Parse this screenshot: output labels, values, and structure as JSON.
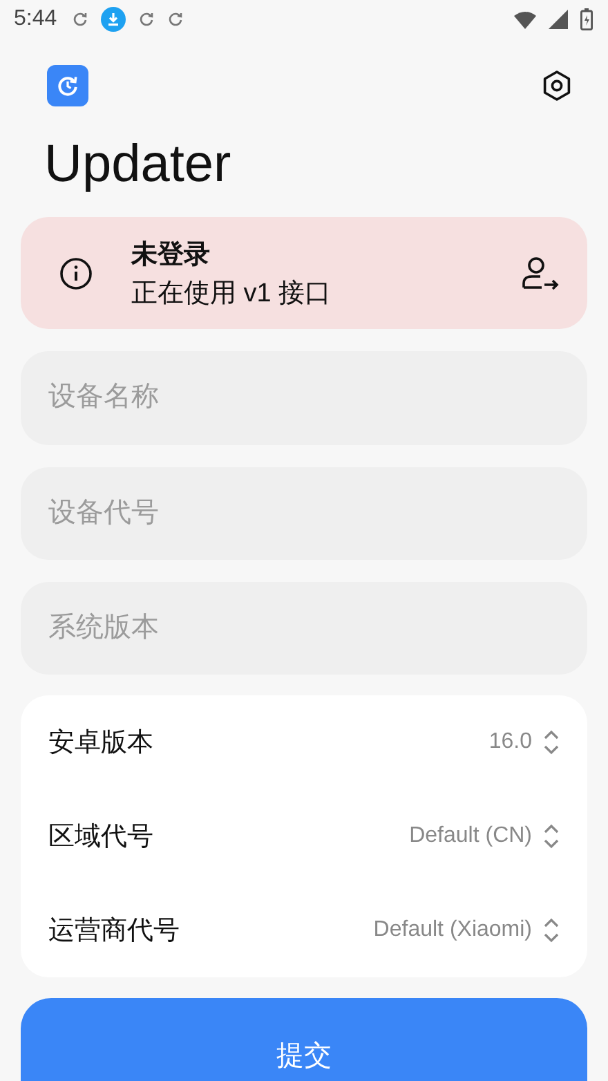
{
  "status_bar": {
    "time": "5:44"
  },
  "header": {
    "title": "Updater"
  },
  "login_card": {
    "title": "未登录",
    "subtitle": "正在使用 v1 接口"
  },
  "fields": [
    {
      "placeholder": "设备名称"
    },
    {
      "placeholder": "设备代号"
    },
    {
      "placeholder": "系统版本"
    }
  ],
  "selectors": [
    {
      "label": "安卓版本",
      "value": "16.0"
    },
    {
      "label": "区域代号",
      "value": "Default (CN)"
    },
    {
      "label": "运营商代号",
      "value": "Default (Xiaomi)"
    }
  ],
  "submit_button": {
    "label": "提交"
  }
}
